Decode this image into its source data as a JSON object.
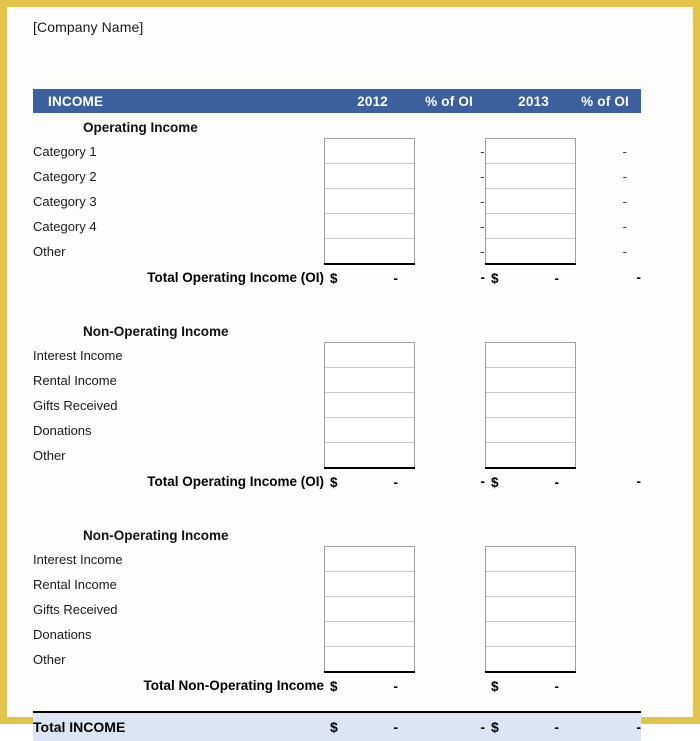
{
  "page": {
    "company_name": "[Company Name]",
    "border_color": "#e3c44a",
    "header_bg": "#3c5f9e",
    "header_fg": "#ffffff",
    "grand_total_bg": "#dbe5f3"
  },
  "header": {
    "title": "INCOME",
    "col_year_1": "2012",
    "col_pct_1": "% of OI",
    "col_year_2": "2013",
    "col_pct_2": "% of OI"
  },
  "sections": [
    {
      "title": "Operating Income",
      "items": [
        {
          "label": "Category 1",
          "y1_value": "",
          "p1_value": "-",
          "y2_value": "",
          "p2_value": "-"
        },
        {
          "label": "Category 2",
          "y1_value": "",
          "p1_value": "-",
          "y2_value": "",
          "p2_value": "-"
        },
        {
          "label": "Category 3",
          "y1_value": "",
          "p1_value": "-",
          "y2_value": "",
          "p2_value": "-"
        },
        {
          "label": "Category 4",
          "y1_value": "",
          "p1_value": "-",
          "y2_value": "",
          "p2_value": "-"
        },
        {
          "label": "Other",
          "y1_value": "",
          "p1_value": "-",
          "y2_value": "",
          "p2_value": "-"
        }
      ],
      "total": {
        "label": "Total Operating Income (OI)",
        "y1_currency": "$",
        "y1_value": "-",
        "p1_value": "-",
        "y2_currency": "$",
        "y2_value": "-",
        "p2_value": "-"
      }
    },
    {
      "title": "Non-Operating Income",
      "items": [
        {
          "label": "Interest Income",
          "y1_value": "",
          "p1_value": "",
          "y2_value": "",
          "p2_value": ""
        },
        {
          "label": "Rental Income",
          "y1_value": "",
          "p1_value": "",
          "y2_value": "",
          "p2_value": ""
        },
        {
          "label": "Gifts Received",
          "y1_value": "",
          "p1_value": "",
          "y2_value": "",
          "p2_value": ""
        },
        {
          "label": "Donations",
          "y1_value": "",
          "p1_value": "",
          "y2_value": "",
          "p2_value": ""
        },
        {
          "label": "Other",
          "y1_value": "",
          "p1_value": "",
          "y2_value": "",
          "p2_value": ""
        }
      ],
      "total": {
        "label": "Total Operating Income (OI)",
        "y1_currency": "$",
        "y1_value": "-",
        "p1_value": "-",
        "y2_currency": "$",
        "y2_value": "-",
        "p2_value": "-"
      }
    },
    {
      "title": "Non-Operating Income",
      "items": [
        {
          "label": "Interest Income",
          "y1_value": "",
          "p1_value": "",
          "y2_value": "",
          "p2_value": ""
        },
        {
          "label": "Rental Income",
          "y1_value": "",
          "p1_value": "",
          "y2_value": "",
          "p2_value": ""
        },
        {
          "label": "Gifts Received",
          "y1_value": "",
          "p1_value": "",
          "y2_value": "",
          "p2_value": ""
        },
        {
          "label": "Donations",
          "y1_value": "",
          "p1_value": "",
          "y2_value": "",
          "p2_value": ""
        },
        {
          "label": "Other",
          "y1_value": "",
          "p1_value": "",
          "y2_value": "",
          "p2_value": ""
        }
      ],
      "total": {
        "label": "Total Non-Operating Income",
        "y1_currency": "$",
        "y1_value": "-",
        "p1_value": "",
        "y2_currency": "$",
        "y2_value": "-",
        "p2_value": ""
      }
    }
  ],
  "grand_total": {
    "label": "Total INCOME",
    "y1_currency": "$",
    "y1_value": "-",
    "p1_value": "-",
    "y2_currency": "$",
    "y2_value": "-",
    "p2_value": "-"
  }
}
